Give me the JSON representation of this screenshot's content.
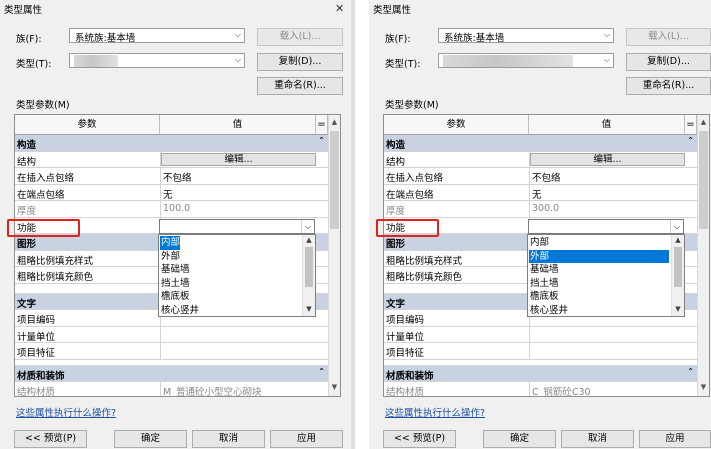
{
  "left": {
    "title": "类型属性",
    "family_label": "族(F):",
    "family_value": "系统族:基本墙",
    "type_label": "类型(T):",
    "load_button": "载入(L)...",
    "duplicate_button": "复制(D)...",
    "rename_button": "重命名(R)...",
    "type_params_label": "类型参数(M)",
    "col_param": "参数",
    "col_value": "值",
    "sort_glyph": "=",
    "groups": {
      "construction": "构造",
      "graphics": "图形",
      "text": "文字",
      "materials": "材质和装饰"
    },
    "rows": {
      "structure": "结构",
      "structure_edit": "编辑...",
      "wrap_insert": "在插入点包络",
      "wrap_insert_value": "不包络",
      "wrap_end": "在端点包络",
      "wrap_end_value": "无",
      "thickness": "厚度",
      "thickness_value": "100.0",
      "function": "功能",
      "function_value": "内部",
      "coarse_pattern": "粗略比例填充样式",
      "coarse_color": "粗略比例填充颜色",
      "item_code": "项目编码",
      "unit": "计量单位",
      "item_feature": "项目特征",
      "struct_material": "结构材质",
      "struct_material_value": "M_普通砼小型空心砌块"
    },
    "dropdown": [
      "内部",
      "外部",
      "基础墙",
      "挡土墙",
      "檐底板",
      "核心竖井"
    ],
    "dropdown_selected": "内部",
    "help_link": "这些属性执行什么操作?",
    "preview_button": "<< 预览(P)",
    "ok_button": "确定",
    "cancel_button": "取消",
    "apply_button": "应用"
  },
  "right": {
    "title": "类型属性",
    "family_label": "族(F):",
    "family_value": "系统族:基本墙",
    "type_label": "类型(T):",
    "load_button": "载入(L)...",
    "duplicate_button": "复制(D)...",
    "rename_button": "重命名(R)...",
    "type_params_label": "类型参数(M)",
    "col_param": "参数",
    "col_value": "值",
    "sort_glyph": "=",
    "groups": {
      "construction": "构造",
      "graphics": "图形",
      "text": "文字",
      "materials": "材质和装饰"
    },
    "rows": {
      "structure": "结构",
      "structure_edit": "编辑...",
      "wrap_insert": "在插入点包络",
      "wrap_insert_value": "不包络",
      "wrap_end": "在端点包络",
      "wrap_end_value": "无",
      "thickness": "厚度",
      "thickness_value": "300.0",
      "function": "功能",
      "function_value": "外部",
      "coarse_pattern": "粗略比例填充样式",
      "coarse_color": "粗略比例填充颜色",
      "item_code": "项目编码",
      "unit": "计量单位",
      "item_feature": "项目特征",
      "struct_material": "结构材质",
      "struct_material_value": "C_钢筋砼C30"
    },
    "dropdown": [
      "内部",
      "外部",
      "基础墙",
      "挡土墙",
      "檐底板",
      "核心竖井"
    ],
    "dropdown_selected": "外部",
    "help_link": "这些属性执行什么操作?",
    "preview_button": "<< 预览(P)",
    "ok_button": "确定",
    "cancel_button": "取消",
    "apply_button": "应用"
  },
  "colors": {
    "group_header": "#c8d2e2",
    "selection": "#0078d7",
    "highlight_box": "#e0241d",
    "link": "#1a4fa6"
  }
}
